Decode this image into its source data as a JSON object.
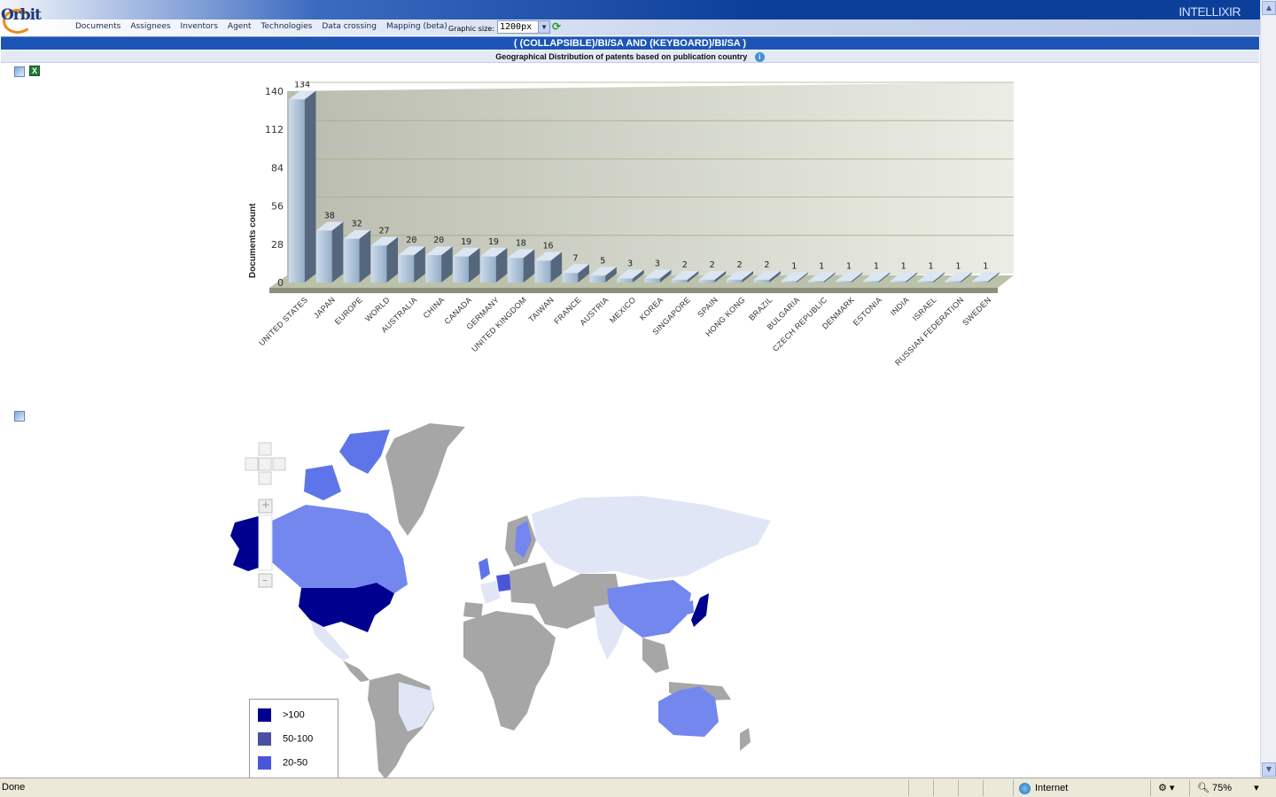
{
  "app": {
    "logo": "Orbit",
    "brand": "INTELLIXIR"
  },
  "nav": [
    "Documents",
    "Assignees",
    "Inventors",
    "Agent",
    "Technologies",
    "Data crossing",
    "Mapping (beta)"
  ],
  "graphic_size": {
    "label": "Graphic size:",
    "value": "1200px"
  },
  "query": "( (COLLAPSIBLE)/BI/SA AND (KEYBOARD)/BI/SA )",
  "subtitle": "Geographical Distribution of patents based on publication country",
  "chart_data": {
    "type": "bar",
    "ylabel": "Documents count",
    "ylim": [
      0,
      140
    ],
    "yticks": [
      0,
      28,
      56,
      84,
      112,
      140
    ],
    "categories": [
      "UNITED STATES",
      "JAPAN",
      "EUROPE",
      "WORLD",
      "AUSTRALIA",
      "CHINA",
      "CANADA",
      "GERMANY",
      "UNITED KINGDOM",
      "TAIWAN",
      "FRANCE",
      "AUSTRIA",
      "MEXICO",
      "KOREA",
      "SINGAPORE",
      "SPAIN",
      "HONG KONG",
      "BRAZIL",
      "BULGARIA",
      "CZECH REPUBLIC",
      "DENMARK",
      "ESTONIA",
      "INDIA",
      "ISRAEL",
      "RUSSIAN FEDERATION",
      "SWEDEN"
    ],
    "values": [
      134,
      38,
      32,
      27,
      20,
      20,
      19,
      19,
      18,
      16,
      7,
      5,
      3,
      3,
      2,
      2,
      2,
      2,
      1,
      1,
      1,
      1,
      1,
      1,
      1,
      1
    ],
    "colors": {
      "bar_top": "#dbe6f2",
      "bar_front": "#b4c8dc",
      "bar_side": "#55677c",
      "plot_bg": "#c9cbbd",
      "floor": "#bcc2a9"
    }
  },
  "map": {
    "legend": [
      {
        "label": ">100",
        "color": "#00008f"
      },
      {
        "label": "50-100",
        "color": "#4a4fa3"
      },
      {
        "label": "20-50",
        "color": "#4a56da"
      }
    ],
    "colors": {
      "gt100": "#00008f",
      "20-50": "#7487ef",
      "low": "#e1e6f7",
      "none": "#a6a6a6",
      "mid": "#5e75ea"
    }
  },
  "status": {
    "text": "Done",
    "zone": "Internet",
    "zoom": "75%"
  }
}
